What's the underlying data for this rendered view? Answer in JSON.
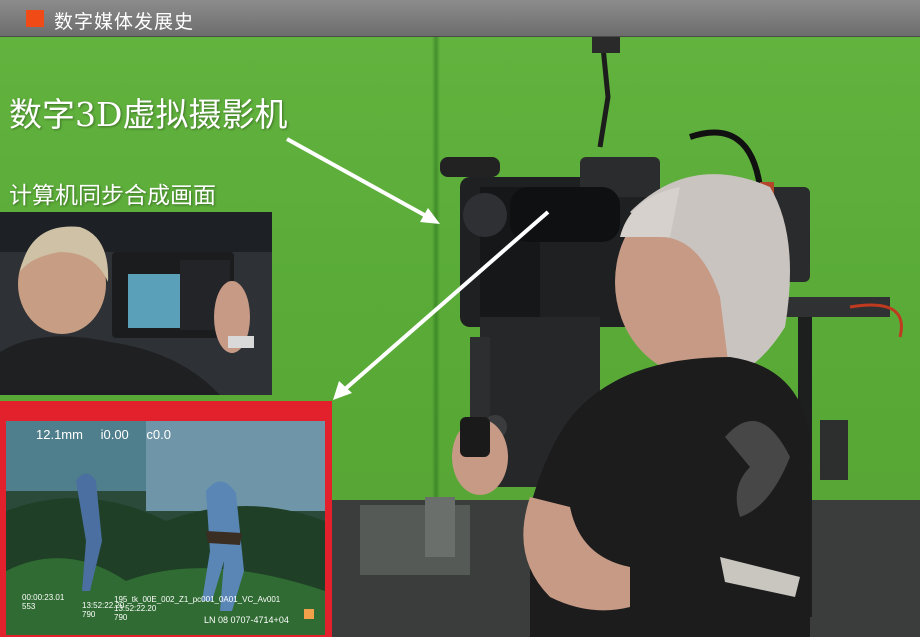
{
  "header": {
    "title": "数字媒体发展史",
    "accent_color": "#f04a16"
  },
  "slide": {
    "main_caption": "数字3D虚拟摄影机",
    "sub_caption": "计算机同步合成画面"
  },
  "monitor_hud": {
    "focal_length": "12.1mm",
    "iris": "i0.00",
    "c_value": "c0.0",
    "timecode_a": "00:00:23.01",
    "timecode_a_sub": "553",
    "timecode_b": "13:52:22.20",
    "timecode_b_sub": "790",
    "timecode_c": "13:52:22.20",
    "timecode_c_sub": "790",
    "clip_name": "195_tk_00E_002_Z1_pc001_0A01_VC_Av001",
    "ln_line": "LN 08 0707-4714+04",
    "frame_color": "#e2212c"
  },
  "icons": [
    "slide-bullet-square",
    "arrow-to-camera",
    "arrow-to-monitor"
  ]
}
